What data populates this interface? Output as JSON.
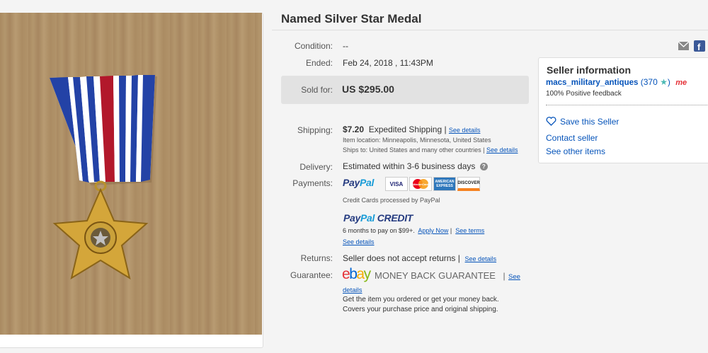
{
  "listing": {
    "title": "Named Silver Star Medal"
  },
  "details": {
    "condition_label": "Condition:",
    "condition_value": "--",
    "ended_label": "Ended:",
    "ended_value": "Feb 24, 2018 , 11:43PM",
    "sold_label": "Sold for:",
    "sold_value": "US $295.00",
    "shipping_label": "Shipping:",
    "shipping_price": "$7.20",
    "shipping_method": "Expedited Shipping |",
    "shipping_see_details": "See details",
    "item_location": "Item location:  Minneapolis, Minnesota, United States",
    "ships_to": "Ships to:  United States and many other countries |",
    "ships_see_details": "See details",
    "delivery_label": "Delivery:",
    "delivery_value": "Estimated within 3-6 business days",
    "payments_label": "Payments:",
    "paypal_a": "Pay",
    "paypal_b": "Pal",
    "card_visa": "VISA",
    "card_mc": "MasterCard",
    "card_amex": "AMERICAN EXPRESS",
    "card_discover": "DISCOVER",
    "cc_note": "Credit Cards processed by PayPal",
    "ppcredit_a": "Pay",
    "ppcredit_b": "Pal",
    "ppcredit_c": " CREDIT",
    "ppcredit_terms": "6 months to pay on $99+.",
    "apply_now": "Apply Now",
    "see_terms": "See terms",
    "pp_see_details": "See details",
    "returns_label": "Returns:",
    "returns_value": "Seller does not accept returns |",
    "returns_see_details": "See details",
    "guarantee_label": "Guarantee:",
    "ebay_e": "e",
    "ebay_b": "b",
    "ebay_a": "a",
    "ebay_y": "y",
    "mbg": "MONEY BACK GUARANTEE",
    "mbg_sep": "|",
    "mbg_see": "See",
    "mbg_details": "details",
    "guarantee_line1": "Get the item you ordered or get your money back.",
    "guarantee_line2": "Covers your purchase price and original shipping."
  },
  "seller": {
    "heading": "Seller information",
    "name": "macs_military_antiques",
    "score": "(370",
    "score_close": ")",
    "star": "★",
    "me_badge": "me",
    "feedback": "100% Positive feedback",
    "save": "Save this Seller",
    "contact": "Contact seller",
    "other": "See other items"
  },
  "colors": {
    "link": "#0654ba",
    "ebay_e": "#e53238",
    "ebay_b": "#0064d2",
    "ebay_a": "#f5af02",
    "ebay_y": "#86b817",
    "star": "#4cbab4"
  }
}
